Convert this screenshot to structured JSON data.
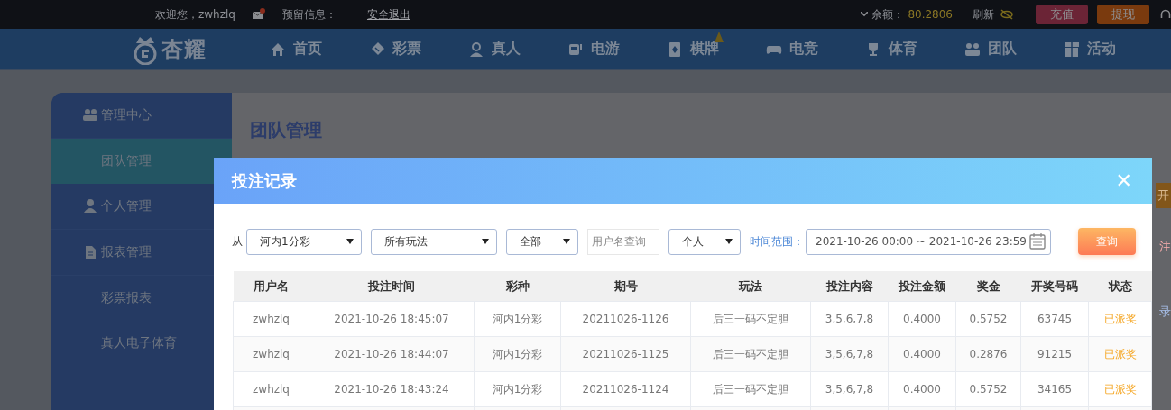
{
  "top_bar": {
    "welcome": "欢迎您，zwhzlq",
    "reserved_label": "预留信息：",
    "logout": "安全退出",
    "balance_label": "余额：",
    "balance": "80.2806",
    "refresh": "刷新",
    "buttons": [
      {
        "label": "充值",
        "kind": "deposit"
      },
      {
        "label": "提现",
        "kind": "withdraw"
      }
    ]
  },
  "nav": {
    "logo": "杏耀",
    "items": [
      {
        "label": "首页"
      },
      {
        "label": "彩票"
      },
      {
        "label": "真人"
      },
      {
        "label": "电游"
      },
      {
        "label": "棋牌"
      },
      {
        "label": "电竞"
      },
      {
        "label": "体育"
      },
      {
        "label": "团队"
      },
      {
        "label": "活动"
      }
    ]
  },
  "sidebar": {
    "items": [
      {
        "label": "管理中心",
        "kind": "section",
        "selected": false
      },
      {
        "label": "团队管理",
        "kind": "link",
        "selected": true
      },
      {
        "label": "个人管理",
        "kind": "section",
        "selected": false
      },
      {
        "label": "报表管理",
        "kind": "section",
        "selected": false
      },
      {
        "label": "彩票报表",
        "kind": "link",
        "selected": false
      },
      {
        "label": "真人电子体育",
        "kind": "link",
        "selected": false
      }
    ]
  },
  "content": {
    "title": "团队管理",
    "edge_fragments": [
      {
        "text": "开",
        "kind": "button"
      },
      {
        "text": "注",
        "kind": "red"
      },
      {
        "text": "录",
        "kind": "link"
      }
    ]
  },
  "modal": {
    "title": "投注记录",
    "close": "✕",
    "filters": {
      "from_label": "从",
      "lottery": "河内1分彩",
      "play": "所有玩法",
      "status": "全部",
      "username_placeholder": "用户名查询",
      "scope": "个人",
      "range_label": "时间范围：",
      "range": "2021-10-26 00:00 ~ 2021-10-26 23:59",
      "search_button": "查询"
    },
    "table": {
      "columns": [
        "用户名",
        "投注时间",
        "彩种",
        "期号",
        "玩法",
        "投注内容",
        "投注金额",
        "奖金",
        "开奖号码",
        "状态"
      ],
      "rows": [
        [
          "zwhzlq",
          "2021-10-26 18:45:07",
          "河内1分彩",
          "20211026-1126",
          "后三一码不定胆",
          "3,5,6,7,8",
          "0.4000",
          "0.5752",
          "63745",
          "已派奖"
        ],
        [
          "zwhzlq",
          "2021-10-26 18:44:07",
          "河内1分彩",
          "20211026-1125",
          "后三一码不定胆",
          "3,5,6,7,8",
          "0.4000",
          "0.2876",
          "91215",
          "已派奖"
        ],
        [
          "zwhzlq",
          "2021-10-26 18:43:24",
          "河内1分彩",
          "20211026-1124",
          "后三一码不定胆",
          "3,5,6,7,8",
          "0.4000",
          "0.5752",
          "34165",
          "已派奖"
        ]
      ]
    }
  }
}
